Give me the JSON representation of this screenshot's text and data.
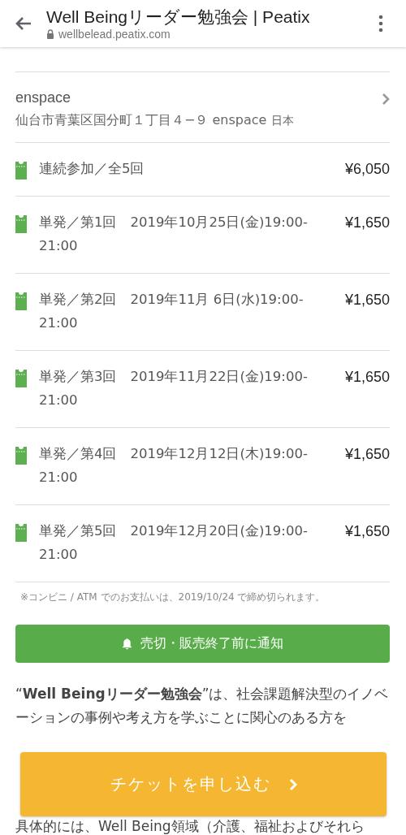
{
  "browser": {
    "title": "Well Beingリーダー勉強会 | Peatix",
    "url": "wellbelead.peatix.com"
  },
  "venue": {
    "name": "enspace",
    "address": "仙台市青葉区国分町１丁目４−９ enspace",
    "country": "日本"
  },
  "tickets": [
    {
      "label": "連続参加／全5回",
      "price": "¥6,050"
    },
    {
      "label": "単発／第1回　2019年10月25日(金)19:00-21:00",
      "price": "¥1,650"
    },
    {
      "label": "単発／第2回　2019年11月 6日(水)19:00-21:00",
      "price": "¥1,650"
    },
    {
      "label": "単発／第3回　2019年11月22日(金)19:00-21:00",
      "price": "¥1,650"
    },
    {
      "label": "単発／第4回　2019年12月12日(木)19:00-21:00",
      "price": "¥1,650"
    },
    {
      "label": "単発／第5回　2019年12月20日(金)19:00-21:00",
      "price": "¥1,650"
    }
  ],
  "payment_note": "※コンビニ / ATM でのお支払いは、2019/10/24 で締め切られます。",
  "notify_button": "売切・販売終了前に通知",
  "description": "“**Well Beingリーダー勉強会**”は、社会課題解決型のイノベーションの事例や考え方を学ぶことに関心のある方を",
  "description_2": "具体的には、Well Being領域（介護、福祉およびそれら",
  "apply_button": "チケットを申し込む"
}
